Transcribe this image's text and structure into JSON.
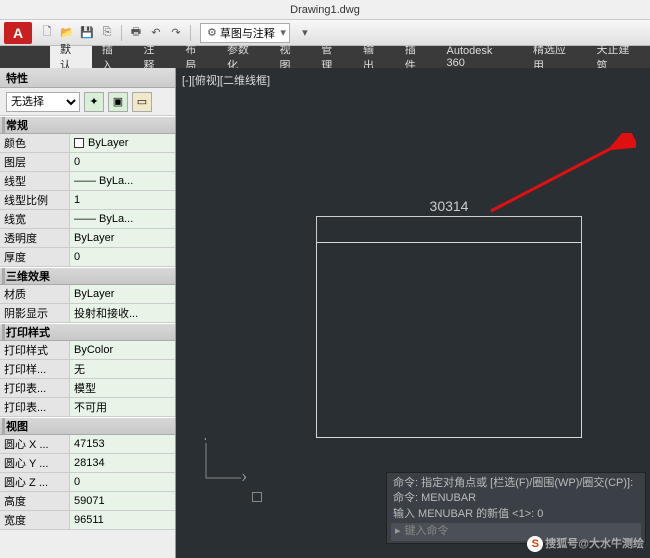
{
  "title": "Drawing1.dwg",
  "workspace": {
    "label": "草图与注释"
  },
  "ribbon": {
    "tabs": [
      "默认",
      "插入",
      "注释",
      "布局",
      "参数化",
      "视图",
      "管理",
      "输出",
      "插件",
      "Autodesk 360",
      "精选应用",
      "天正建筑"
    ],
    "active": 0
  },
  "properties": {
    "title": "特性",
    "selection": "无选择",
    "groups": [
      {
        "name": "常规",
        "items": [
          {
            "label": "颜色",
            "value": "ByLayer",
            "swatch": true
          },
          {
            "label": "图层",
            "value": "0"
          },
          {
            "label": "线型",
            "value": "—— ByLa..."
          },
          {
            "label": "线型比例",
            "value": "1"
          },
          {
            "label": "线宽",
            "value": "—— ByLa..."
          },
          {
            "label": "透明度",
            "value": "ByLayer"
          },
          {
            "label": "厚度",
            "value": "0"
          }
        ]
      },
      {
        "name": "三维效果",
        "items": [
          {
            "label": "材质",
            "value": "ByLayer"
          },
          {
            "label": "阴影显示",
            "value": "投射和接收..."
          }
        ]
      },
      {
        "name": "打印样式",
        "items": [
          {
            "label": "打印样式",
            "value": "ByColor"
          },
          {
            "label": "打印样...",
            "value": "无"
          },
          {
            "label": "打印表...",
            "value": "模型"
          },
          {
            "label": "打印表...",
            "value": "不可用"
          }
        ]
      },
      {
        "name": "视图",
        "items": [
          {
            "label": "圆心 X ...",
            "value": "47153"
          },
          {
            "label": "圆心 Y ...",
            "value": "28134"
          },
          {
            "label": "圆心 Z ...",
            "value": "0"
          },
          {
            "label": "高度",
            "value": "59071"
          },
          {
            "label": "宽度",
            "value": "96511"
          }
        ]
      }
    ]
  },
  "viewport": {
    "label": "[-][俯视][二维线框]",
    "dimension": "30314",
    "ucs_x": "X",
    "ucs_y": "Y"
  },
  "commandline": {
    "line1": "命令: 指定对角点或 [栏选(F)/圈围(WP)/圈交(CP)]:",
    "line2": "命令: MENUBAR",
    "line3": "输入 MENUBAR 的新值 <1>: 0",
    "prompt": "▸",
    "placeholder": "键入命令"
  },
  "watermark": "搜狐号@大水牛测绘"
}
